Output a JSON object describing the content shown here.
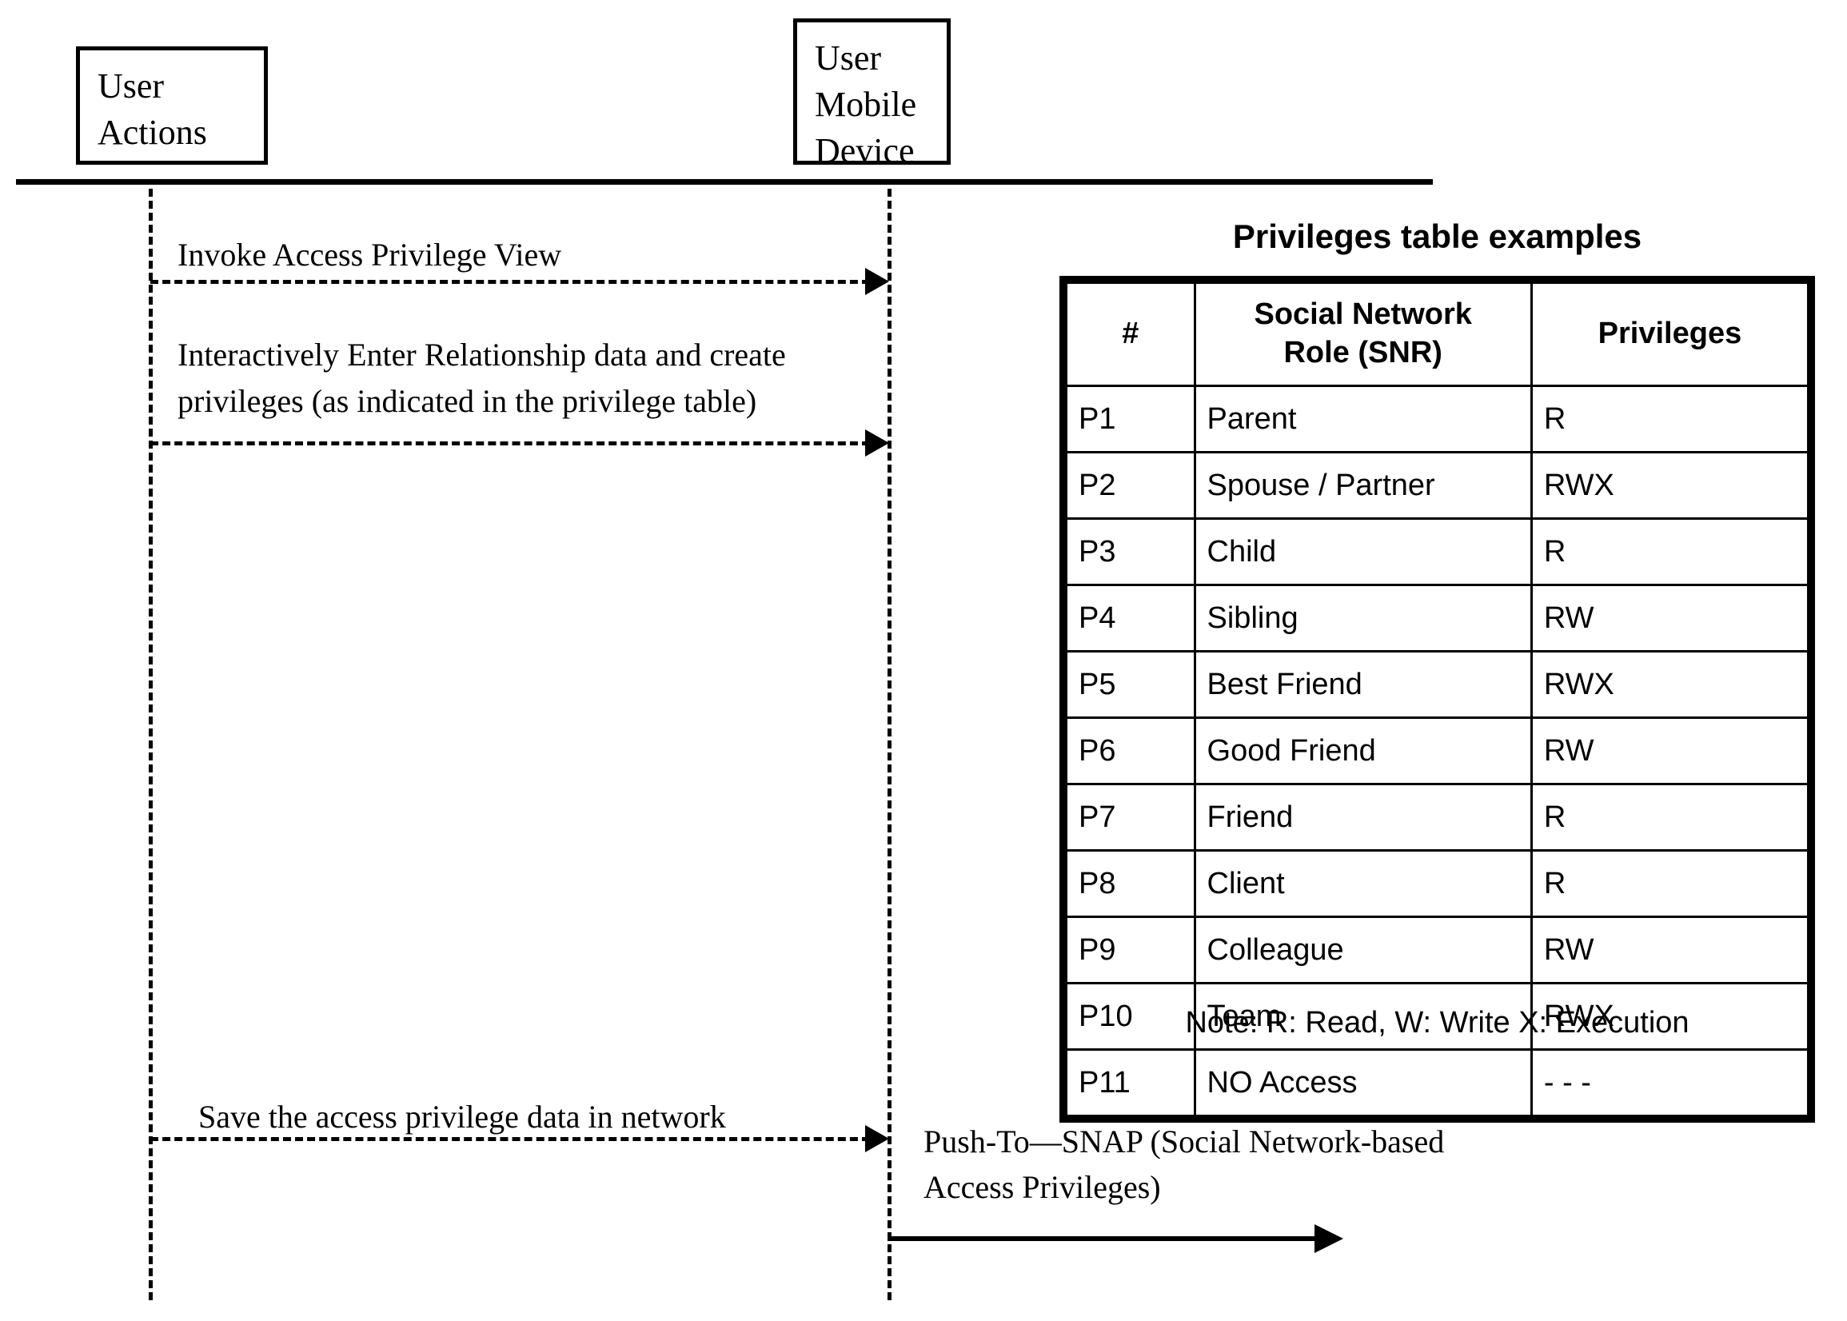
{
  "diagram": {
    "actors": [
      {
        "id": "user-actions",
        "label": "User\nActions"
      },
      {
        "id": "mobile-device",
        "label": "User\nMobile\nDevice"
      }
    ],
    "messages": [
      {
        "id": "m1",
        "label": "Invoke Access Privilege View",
        "style": "dashed",
        "direction": "right"
      },
      {
        "id": "m2",
        "label": "Interactively Enter Relationship data and create\nprivileges (as indicated in the privilege table)",
        "style": "dashed",
        "direction": "right"
      },
      {
        "id": "m3",
        "label": "Save the access privilege data in network",
        "style": "dashed",
        "direction": "right"
      }
    ],
    "outgoing": {
      "label": "Push-To—SNAP (Social Network-based\nAccess Privileges)",
      "style": "solid",
      "direction": "right"
    }
  },
  "table": {
    "title": "Privileges table examples",
    "note": "Note: R: Read, W: Write X: Execution",
    "headers": [
      "#",
      "Social Network\nRole (SNR)",
      "Privileges"
    ],
    "rows": [
      {
        "num": "P1",
        "role": "Parent",
        "privileges": "R"
      },
      {
        "num": "P2",
        "role": "Spouse / Partner",
        "privileges": "RWX"
      },
      {
        "num": "P3",
        "role": "Child",
        "privileges": "R"
      },
      {
        "num": "P4",
        "role": "Sibling",
        "privileges": "RW"
      },
      {
        "num": "P5",
        "role": "Best Friend",
        "privileges": "RWX"
      },
      {
        "num": "P6",
        "role": "Good Friend",
        "privileges": "RW"
      },
      {
        "num": "P7",
        "role": "Friend",
        "privileges": "R"
      },
      {
        "num": "P8",
        "role": "Client",
        "privileges": "R"
      },
      {
        "num": "P9",
        "role": "Colleague",
        "privileges": "RW"
      },
      {
        "num": "P10",
        "role": "Team",
        "privileges": "RWX"
      },
      {
        "num": "P11",
        "role": "NO Access",
        "privileges": "- - -"
      }
    ]
  },
  "colors": {
    "stroke": "#000000",
    "background": "#ffffff"
  }
}
